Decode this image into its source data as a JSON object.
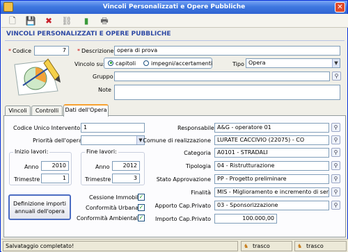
{
  "window": {
    "title": "Vincoli Personalizzati e Opere Pubbliche",
    "close": "✕"
  },
  "toolbar": {
    "new_icon": "🗋",
    "save_icon": "💾",
    "delete_icon": "✖",
    "link_icon": "⛓",
    "exit_icon": "▮",
    "print_icon": "🖶"
  },
  "heading": "VINCOLI PERSONALIZZATI E OPERE PUBBLICHE",
  "form": {
    "req_mark": "*",
    "codice_label": "Codice",
    "codice_value": "7",
    "descrizione_label": "Descrizione",
    "descrizione_value": "opera di prova",
    "vincolo_label": "Vincolo su:",
    "vincolo_options": [
      "capitoli",
      "impegni/accertamenti"
    ],
    "tipo_label": "Tipo",
    "tipo_value": "Opera",
    "gruppo_label": "Gruppo",
    "gruppo_value": "",
    "note_label": "Note",
    "note_value": ""
  },
  "tabs": [
    "Vincoli",
    "Controlli",
    "Dati dell'Opera"
  ],
  "opera": {
    "cui_label": "Codice Unico Intervento",
    "cui_value": "1",
    "priorita_label": "Priorità dell'opera",
    "priorita_value": "",
    "inizio_legend": "Inizio lavori:",
    "inizio_anno_label": "Anno",
    "inizio_anno": "2010",
    "inizio_trim_label": "Trimestre",
    "inizio_trim": "1",
    "fine_legend": "Fine lavori:",
    "fine_anno_label": "Anno",
    "fine_anno": "2012",
    "fine_trim_label": "Trimestre",
    "fine_trim": "3",
    "def_btn": "Definizione importi annuali dell'opera",
    "cessione_label": "Cessione Immobili",
    "urbana_label": "Conformità Urbana",
    "ambientale_label": "Conformità Ambientale",
    "responsabile_label": "Responsabile",
    "responsabile_value": "A&G - operatore 01",
    "comune_label": "Comune di realizzazione",
    "comune_value": "LURATE CACCIVIO (22075) - CO",
    "categoria_label": "Categoria",
    "categoria_value": "A0101 - STRADALI",
    "tipologia_label": "Tipologia",
    "tipologia_value": "04 - Ristrutturazione",
    "stato_label": "Stato Approvazione",
    "stato_value": "PP - Progetto preliminare",
    "finalita_label": "Finalità",
    "finalita_value": "MIS - Miglioramento e incremento di servizio",
    "apporto_label": "Apporto Cap.Privato",
    "apporto_value": "03 - Sponsorizzazione",
    "importo_label": "Importo Cap.Privato",
    "importo_value": "100.000,00"
  },
  "status": {
    "message": "Salvataggio completato!",
    "panel1": "trasco",
    "panel2": "trasco"
  }
}
